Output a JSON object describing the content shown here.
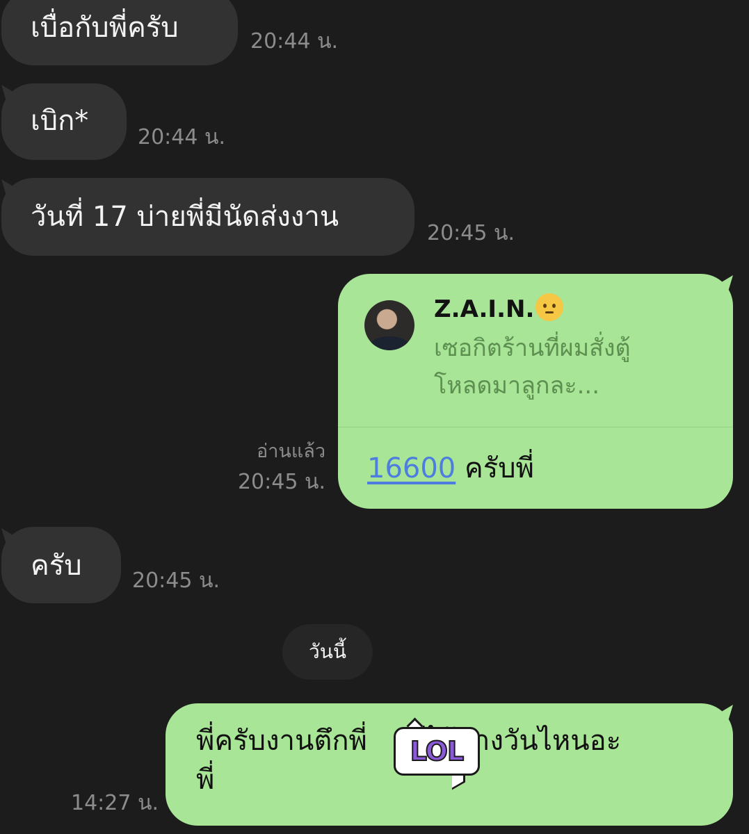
{
  "messages": {
    "m1": {
      "text": "เบื่อกับพี่ครับ",
      "time": "20:44 น."
    },
    "m2": {
      "text": "เบิก*",
      "time": "20:44 น."
    },
    "m3": {
      "text": "วันที่ 17 บ่ายพี่มีนัดส่งงาน",
      "time": "20:45 น."
    },
    "reply": {
      "quoted_name": "Z.A.I.N.",
      "quoted_emoji": "saluting-face-emoji",
      "quoted_line1": "เซอกิตร้านที่ผมสั่งตู้",
      "quoted_line2": "โหลดมาลูกละ...",
      "number": "16600",
      "text": "ครับพี่",
      "read_label": "อ่านแล้ว",
      "time": "20:45 น."
    },
    "m5": {
      "text": "ครับ",
      "time": "20:45 น."
    },
    "date_divider": "วันนี้",
    "m6": {
      "line1": "พี่ครับงานตึกพี่",
      "line1_end": "ได้ตางวันไหนอะ",
      "line2": "พี่",
      "time": "14:27 น."
    },
    "sticker": {
      "text": "LOL",
      "icon": "lol-sticker-icon"
    }
  },
  "colors": {
    "background": "#1c1c1c",
    "incoming_bubble": "#323232",
    "outgoing_bubble": "#a8e596",
    "link": "#4d7dde",
    "timestamp": "#8c8c8c"
  }
}
